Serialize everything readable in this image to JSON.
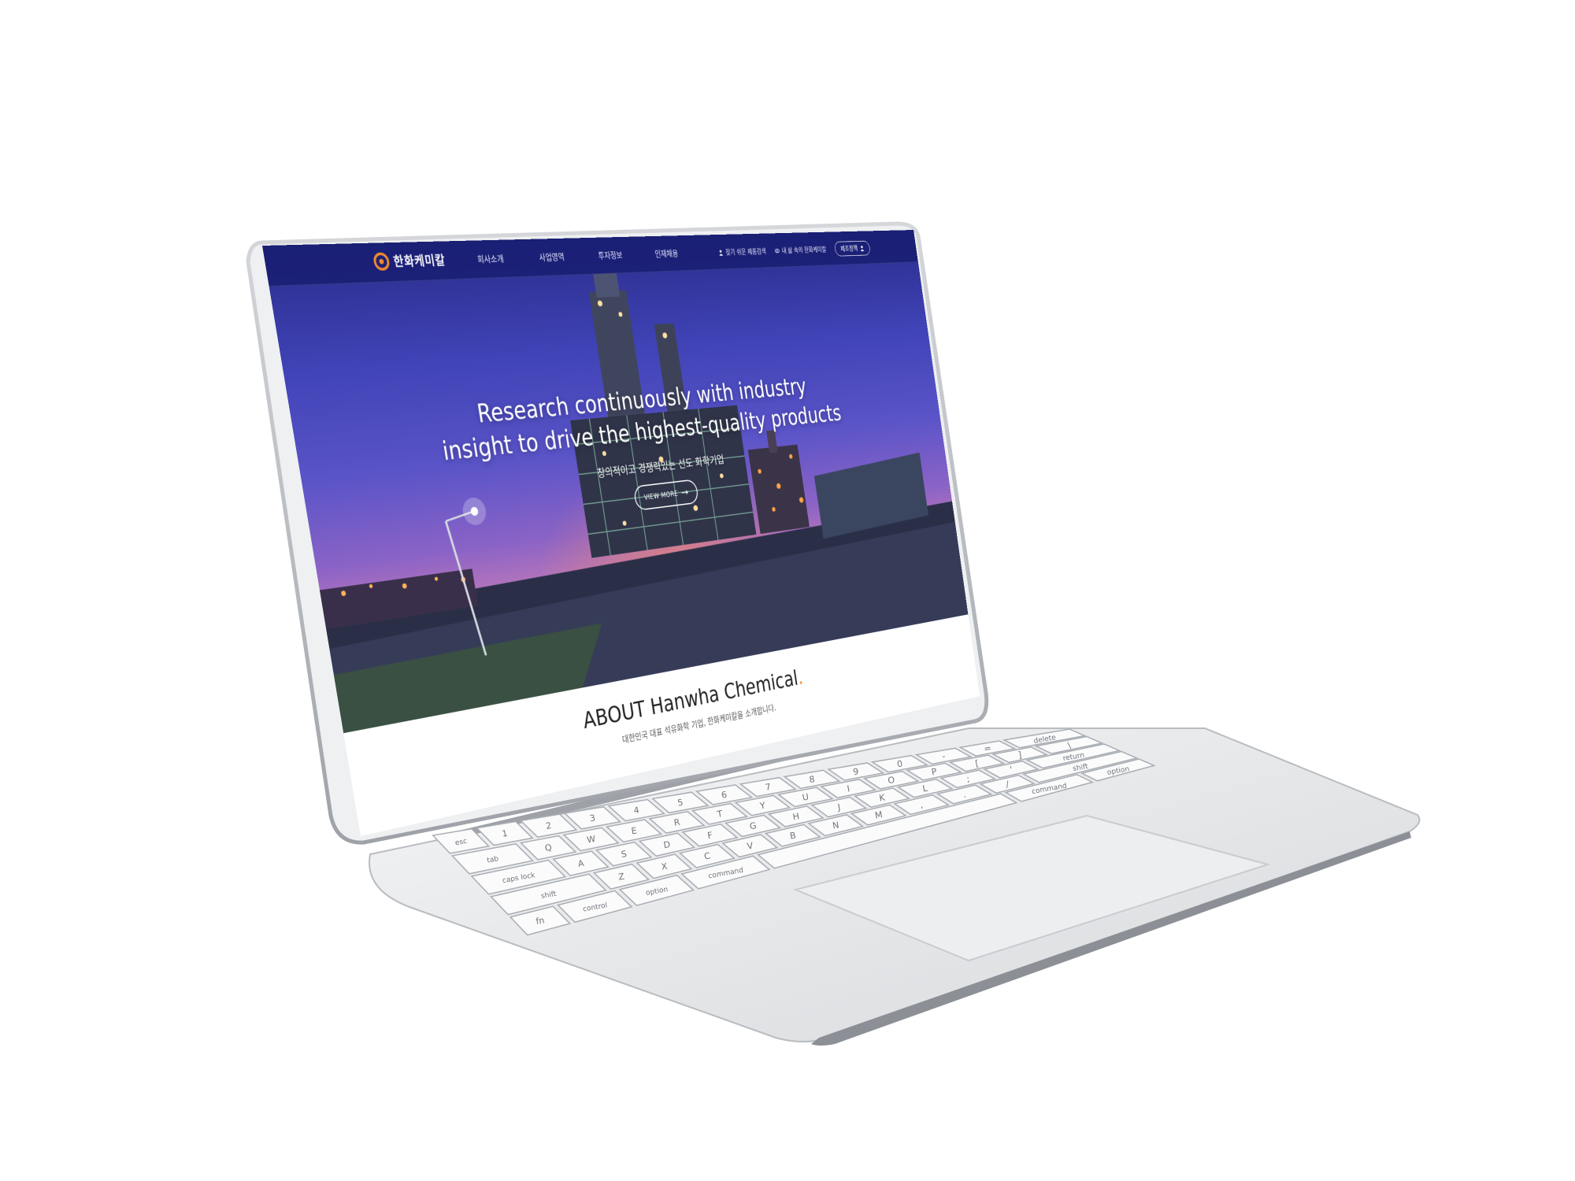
{
  "header": {
    "logo_text": "한화케미칼",
    "nav": [
      "회사소개",
      "사업영역",
      "투자정보",
      "인재채용"
    ],
    "util_links": [
      "찾기 쉬운 제품검색",
      "내 삶 속의 한화케미칼"
    ],
    "util_button": "제조정책"
  },
  "hero": {
    "title_line1": "Research continuously with industry",
    "title_line2": "insight to drive the highest-quality products",
    "subtitle": "창의적이고 경쟁력있는 선도 화학기업",
    "cta_label": "VIEW MORE"
  },
  "about": {
    "title": "ABOUT Hanwha Chemical",
    "title_dot": ".",
    "subtitle": "대한민국 대표 석유화학 기업, 한화케미칼을 소개합니다."
  },
  "keyboard": {
    "row1": [
      "esc",
      "1",
      "2",
      "3",
      "4",
      "5",
      "6",
      "7",
      "8",
      "9",
      "0",
      "-",
      "=",
      "delete"
    ],
    "row2": [
      "tab",
      "Q",
      "W",
      "E",
      "R",
      "T",
      "Y",
      "U",
      "I",
      "O",
      "P",
      "[",
      "]",
      "\\"
    ],
    "row3": [
      "caps lock",
      "A",
      "S",
      "D",
      "F",
      "G",
      "H",
      "J",
      "K",
      "L",
      ";",
      "'",
      "return"
    ],
    "row4": [
      "shift",
      "Z",
      "X",
      "C",
      "V",
      "B",
      "N",
      "M",
      ",",
      ".",
      "/",
      "shift"
    ],
    "row5": [
      "fn",
      "control",
      "option",
      "command",
      "",
      "command",
      "option"
    ]
  },
  "colors": {
    "accent": "#f28a2d",
    "nav_bg": "#1c2270",
    "bezel": "#b9bcc2",
    "body": "#e7e8ea"
  }
}
